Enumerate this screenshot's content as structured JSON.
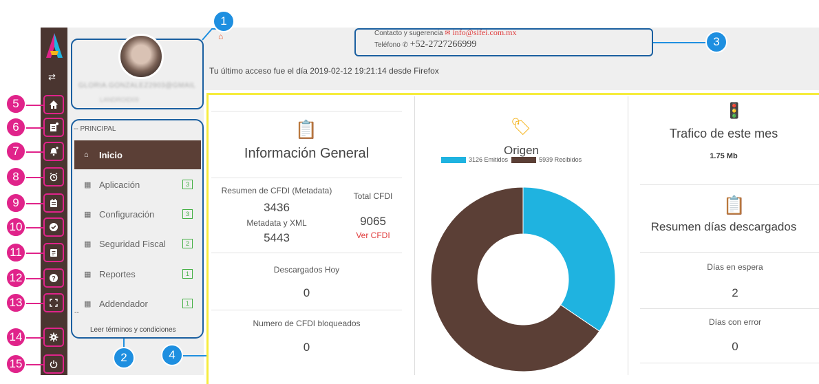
{
  "header": {
    "contact_label": "Contacto y sugerencia",
    "contact_email": "info@sifei.com.mx",
    "phone_label": "Teléfono",
    "phone_number": "+52-2727266999",
    "last_access": "Tu último acceso fue el día 2019-02-12 19:21:14 desde Firefox"
  },
  "user": {
    "email": "GLORIA.GONZALEZ2903@GMAIL",
    "subtitle": "LANDROID09"
  },
  "sidebar": {
    "section_label": "-- PRINCIPAL",
    "items": [
      {
        "label": "Inicio",
        "badge": ""
      },
      {
        "label": "Aplicación",
        "badge": "3"
      },
      {
        "label": "Configuración",
        "badge": "3"
      },
      {
        "label": "Seguridad Fiscal",
        "badge": "2"
      },
      {
        "label": "Reportes",
        "badge": "1"
      },
      {
        "label": "Addendador",
        "badge": "1"
      }
    ],
    "trailing": "--",
    "terms_link": "Leer términos y condiciones"
  },
  "callouts": {
    "n1": "1",
    "n2": "2",
    "n3": "3",
    "n4": "4",
    "n5": "5",
    "n6": "6",
    "n7": "7",
    "n8": "8",
    "n9": "9",
    "n10": "10",
    "n11": "11",
    "n12": "12",
    "n13": "13",
    "n14": "14",
    "n15": "15"
  },
  "info_general": {
    "title": "Información General",
    "resumen_label": "Resumen de CFDI (Metadata)",
    "resumen_value": "3436",
    "metadata_xml_label": "Metadata y XML",
    "metadata_xml_value": "5443",
    "total_label": "Total CFDI",
    "total_value": "9065",
    "ver_cfdi": "Ver CFDI",
    "descargados_label": "Descargados Hoy",
    "descargados_value": "0",
    "bloqueados_label": "Numero de CFDI bloqueados",
    "bloqueados_value": "0"
  },
  "origen": {
    "title": "Origen",
    "emitidos_label": "3126 Emitidos",
    "recibidos_label": "5939 Recibidos"
  },
  "chart_data": {
    "type": "pie",
    "title": "Origen",
    "categories": [
      "Emitidos",
      "Recibidos"
    ],
    "values": [
      3126,
      5939
    ],
    "colors": [
      "#1fb3e0",
      "#5b3f36"
    ],
    "legend": "top"
  },
  "trafico": {
    "title": "Trafico de este mes",
    "value": "1.75 Mb"
  },
  "resumen_dias": {
    "title": "Resumen días descargados",
    "espera_label": "Días en espera",
    "espera_value": "2",
    "error_label": "Días con error",
    "error_value": "0"
  },
  "colors": {
    "accent_brown": "#5b3f36",
    "callout_pink": "#e0238a",
    "callout_blue": "#1e8fe0",
    "highlight_yellow": "#f6ec3d",
    "badge_green": "#46b046"
  }
}
